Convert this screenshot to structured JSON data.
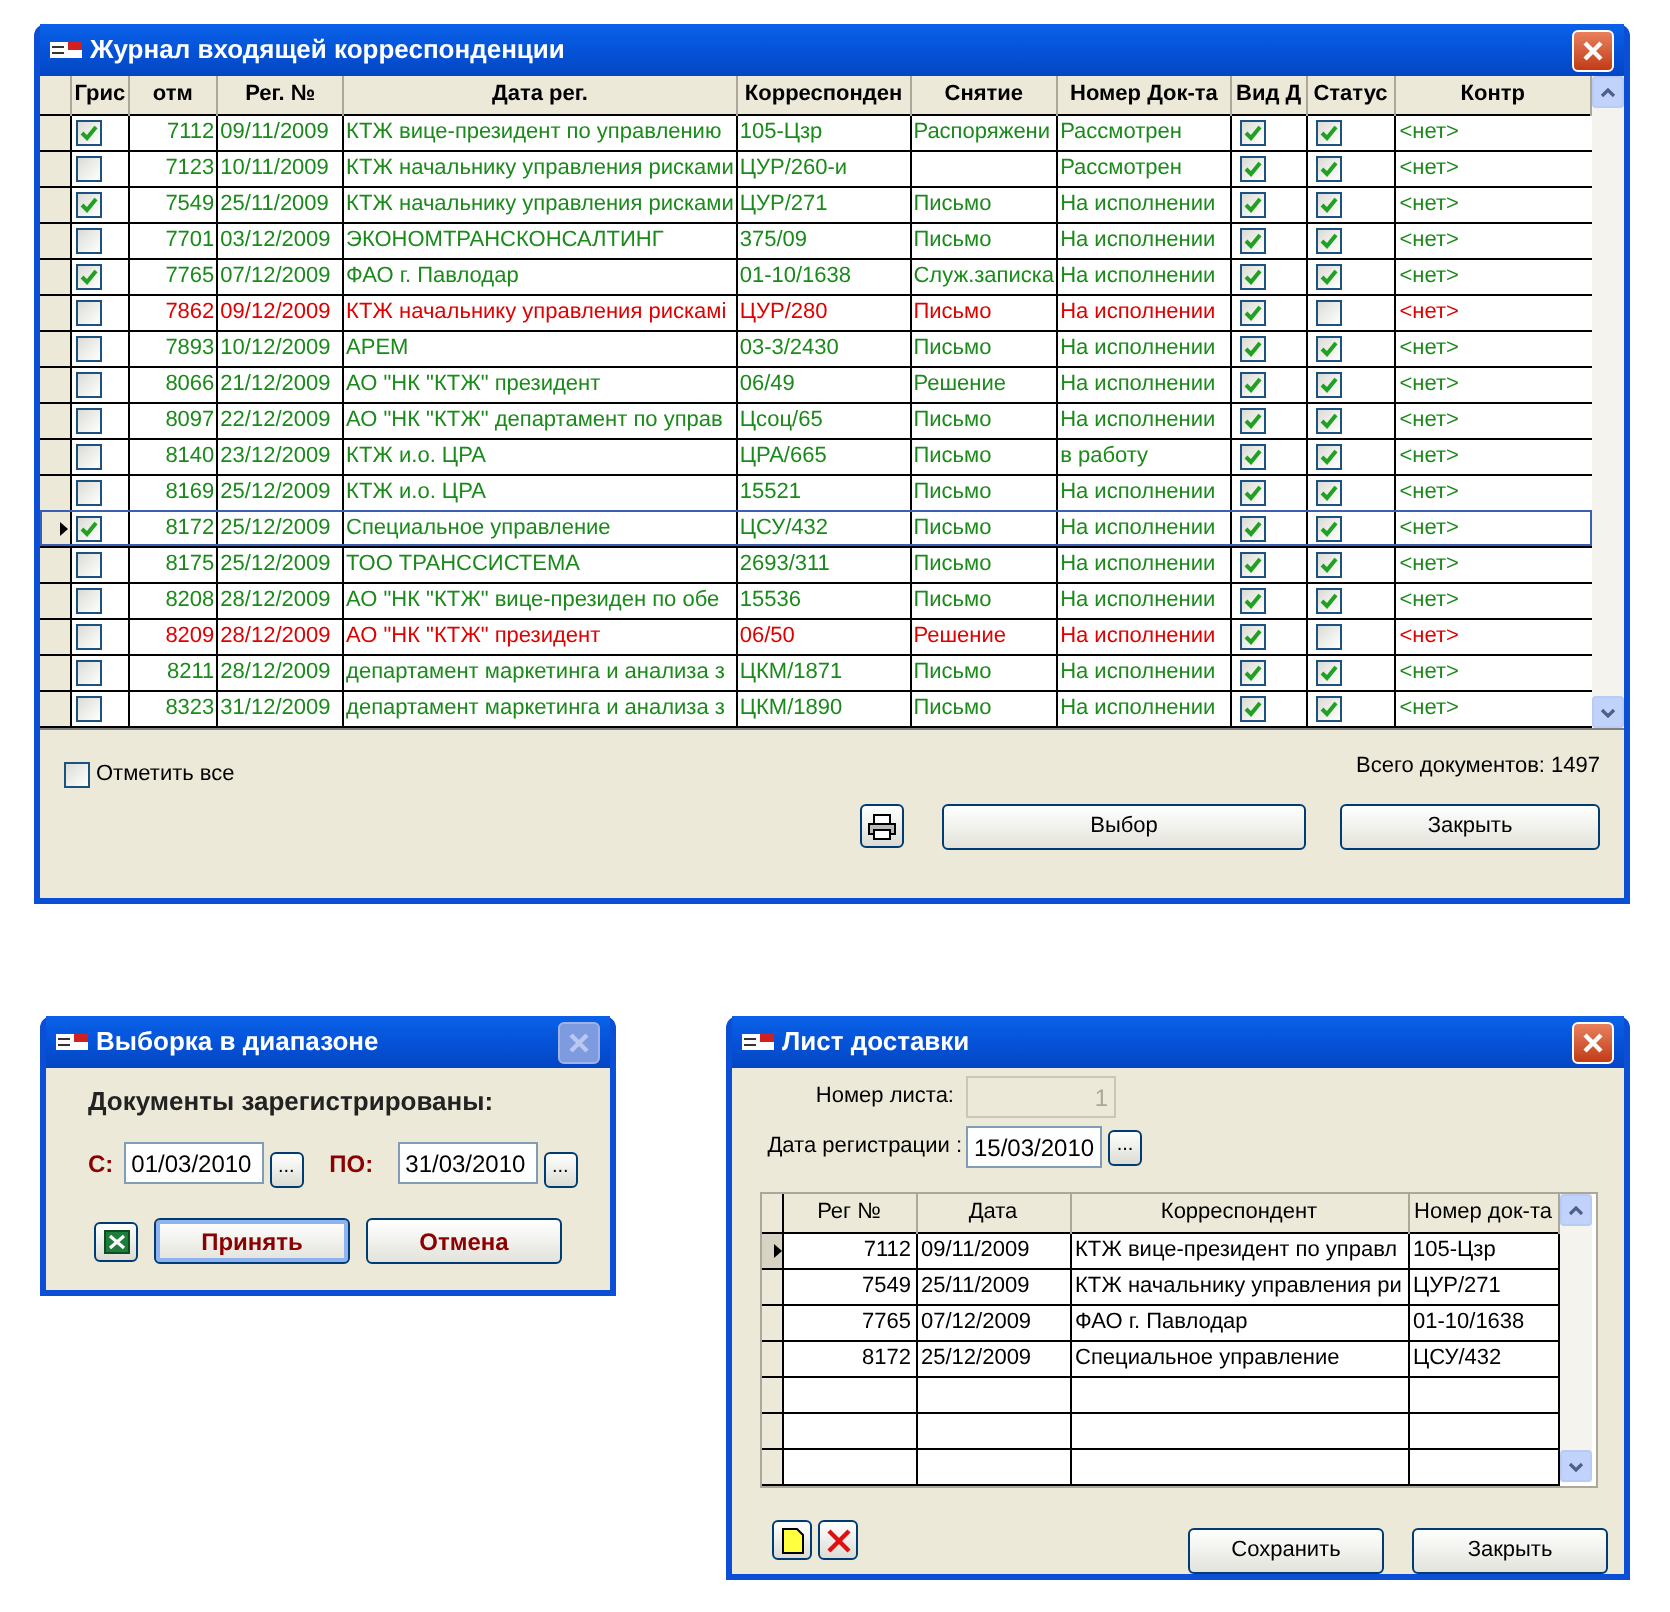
{
  "journal": {
    "title": "Журнал входящей корреспонденции",
    "columns": [
      "Грис",
      "отм",
      "Рег. №",
      "Дата рег.",
      "Корреспонден",
      "Снятие",
      "Номер Док-та",
      "Вид Д",
      "Статус",
      "Контр"
    ],
    "rows": [
      {
        "selected": false,
        "checked": true,
        "color": "#1a8a1a",
        "reg": "7112",
        "date": "09/11/2009",
        "sender": "КТЖ  вице-президент по управлению",
        "doc": "105-Цзр",
        "type": "Распоряжени",
        "state": "Рассмотрен",
        "flags": [
          true,
          true
        ],
        "control": "<нет>"
      },
      {
        "selected": false,
        "checked": false,
        "color": "#1a8a1a",
        "reg": "7123",
        "date": "10/11/2009",
        "sender": "КТЖ начальнику управления рисками",
        "doc": "ЦУР/260-и",
        "state": "Рассмотрен",
        "flags": [
          true,
          true
        ],
        "control": "<нет>"
      },
      {
        "selected": false,
        "checked": true,
        "color": "#1a8a1a",
        "reg": "7549",
        "date": "25/11/2009",
        "sender": "КТЖ начальнику управления рисками",
        "doc": "ЦУР/271",
        "type": "Письмо",
        "state": "На исполнении",
        "flags": [
          true,
          true
        ],
        "control": "<нет>"
      },
      {
        "selected": false,
        "checked": false,
        "color": "#1a8a1a",
        "reg": "7701",
        "date": "03/12/2009",
        "sender": "ЭКОНОМТРАНСКОНСАЛТИНГ",
        "doc": "375/09",
        "type": "Письмо",
        "state": "На исполнении",
        "flags": [
          true,
          true
        ],
        "control": "<нет>"
      },
      {
        "selected": false,
        "checked": true,
        "color": "#1a8a1a",
        "reg": "7765",
        "date": "07/12/2009",
        "sender": "ФАО г. Павлодар",
        "doc": "01-10/1638",
        "type": "Служ.записка",
        "state": "На исполнении",
        "flags": [
          true,
          true
        ],
        "control": "<нет>"
      },
      {
        "selected": false,
        "checked": false,
        "color": "#e00000",
        "reg": "7862",
        "date": "09/12/2009",
        "sender": "КТЖ начальнику управления рискамі",
        "doc": "ЦУР/280",
        "type": "Письмо",
        "state": "На исполнении",
        "flags": [
          true,
          false
        ],
        "control": "<нет>"
      },
      {
        "selected": false,
        "checked": false,
        "color": "#1a8a1a",
        "reg": "7893",
        "date": "10/12/2009",
        "sender": "АРЕМ",
        "doc": "03-3/2430",
        "type": "Письмо",
        "state": "На исполнении",
        "flags": [
          true,
          true
        ],
        "control": "<нет>"
      },
      {
        "selected": false,
        "checked": false,
        "color": "#1a8a1a",
        "reg": "8066",
        "date": "21/12/2009",
        "sender": "АО \"НК \"КТЖ\" президент",
        "doc": "06/49",
        "type": "Решение",
        "state": "На исполнении",
        "flags": [
          true,
          true
        ],
        "control": "<нет>"
      },
      {
        "selected": false,
        "checked": false,
        "color": "#1a8a1a",
        "reg": "8097",
        "date": "22/12/2009",
        "sender": "АО \"НК \"КТЖ\"  департамент по управ",
        "doc": "Цсоц/65",
        "type": "Письмо",
        "state": "На исполнении",
        "flags": [
          true,
          true
        ],
        "control": "<нет>"
      },
      {
        "selected": false,
        "checked": false,
        "color": "#1a8a1a",
        "reg": "8140",
        "date": "23/12/2009",
        "sender": "КТЖ  и.о. ЦРА",
        "doc": "ЦРА/665",
        "type": "Письмо",
        "state": "в работу",
        "flags": [
          true,
          true
        ],
        "control": "<нет>"
      },
      {
        "selected": false,
        "checked": false,
        "color": "#1a8a1a",
        "reg": "8169",
        "date": "25/12/2009",
        "sender": "КТЖ  и.о. ЦРА",
        "doc": "15521",
        "type": "Письмо",
        "state": "На исполнении",
        "flags": [
          true,
          true
        ],
        "control": "<нет>"
      },
      {
        "selected": true,
        "checked": true,
        "color": "#1a8a1a",
        "reg": "8172",
        "date": "25/12/2009",
        "sender": "Специальное  управление",
        "doc": "ЦСУ/432",
        "type": "Письмо",
        "state": "На исполнении",
        "flags": [
          true,
          true
        ],
        "control": "<нет>"
      },
      {
        "selected": false,
        "checked": false,
        "color": "#1a8a1a",
        "reg": "8175",
        "date": "25/12/2009",
        "sender": "ТОО ТРАНССИСТЕМА",
        "doc": "2693/311",
        "type": "Письмо",
        "state": "На исполнении",
        "flags": [
          true,
          true
        ],
        "control": "<нет>"
      },
      {
        "selected": false,
        "checked": false,
        "color": "#1a8a1a",
        "reg": "8208",
        "date": "28/12/2009",
        "sender": "АО \"НК \"КТЖ\"  вице-президен по обе",
        "doc": "15536",
        "type": "Письмо",
        "state": "На исполнении",
        "flags": [
          true,
          true
        ],
        "control": "<нет>"
      },
      {
        "selected": false,
        "checked": false,
        "color": "#e00000",
        "reg": "8209",
        "date": "28/12/2009",
        "sender": "АО \"НК \"КТЖ\" президент",
        "doc": "06/50",
        "type": "Решение",
        "state": "На исполнении",
        "flags": [
          true,
          false
        ],
        "control": "<нет>"
      },
      {
        "selected": false,
        "checked": false,
        "color": "#1a8a1a",
        "reg": "8211",
        "date": "28/12/2009",
        "sender": "департамент маркетинга и анализа з",
        "doc": "ЦКМ/1871",
        "type": "Письмо",
        "state": "На исполнении",
        "flags": [
          true,
          true
        ],
        "control": "<нет>"
      },
      {
        "selected": false,
        "checked": false,
        "color": "#1a8a1a",
        "reg": "8323",
        "date": "31/12/2009",
        "sender": "департамент маркетинга и анализа з",
        "doc": "ЦКМ/1890",
        "type": "Письмо",
        "state": "На исполнении",
        "flags": [
          true,
          true
        ],
        "control": "<нет>"
      }
    ],
    "select_all": {
      "label": "Отметить все",
      "checked": false
    },
    "total": "Всего документов: 1497",
    "buttons": [
      "Выбор",
      "Закрыть"
    ]
  },
  "range_dialog": {
    "title": "Выборка в диапазоне",
    "heading": "Документы зарегистрированы:",
    "from_label": "С:",
    "from_value": "01/03/2010",
    "to_label": "ПО:",
    "to_value": "31/03/2010",
    "picker": "...",
    "buttons": [
      "Принять",
      "Отмена"
    ]
  },
  "delivery_dialog": {
    "title": "Лист доставки",
    "sheet_label": "Номер листа:",
    "sheet_value": "1",
    "date_label": "Дата регистрации :",
    "date_value": "15/03/2010",
    "picker": "...",
    "columns": [
      "Рег №",
      "Дата",
      "Корреспондент",
      "Номер док-та"
    ],
    "rows": [
      {
        "selected": true,
        "values": [
          "7112",
          "09/11/2009",
          "КТЖ  вице-президент по управл",
          "105-Цзр"
        ]
      },
      {
        "selected": false,
        "values": [
          "7549",
          "25/11/2009",
          "КТЖ начальнику управления ри",
          "ЦУР/271"
        ]
      },
      {
        "selected": false,
        "values": [
          "7765",
          "07/12/2009",
          "ФАО г. Павлодар",
          "01-10/1638"
        ]
      },
      {
        "selected": false,
        "values": [
          "8172",
          "25/12/2009",
          "Специальное  управление",
          "ЦСУ/432"
        ]
      }
    ],
    "buttons": [
      "Сохранить",
      "Закрыть"
    ]
  }
}
